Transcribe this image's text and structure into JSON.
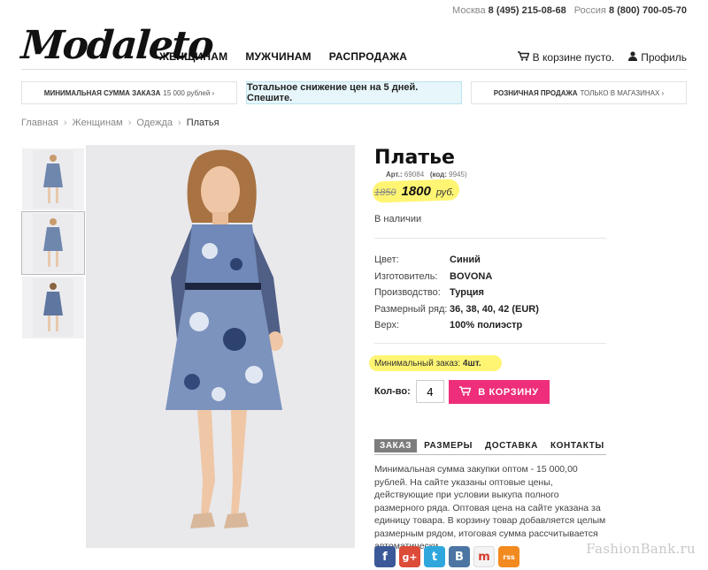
{
  "header": {
    "phone_moscow_label": "Москва",
    "phone_moscow": "8 (495) 215-08-68",
    "phone_russia_label": "Россия",
    "phone_russia": "8 (800) 700-05-70",
    "logo": "Modaleto",
    "nav": [
      "ЖЕНЩИНАМ",
      "МУЖЧИНАМ",
      "РАСПРОДАЖА"
    ],
    "cart_text": "В корзине пусто.",
    "profile_text": "Профиль"
  },
  "promo": {
    "left_bold": "МИНИМАЛЬНАЯ СУММА ЗАКАЗА",
    "left_rest": "15 000 рублей ›",
    "mid": "Тотальное снижение цен на 5 дней. Спешите.",
    "right_bold": "РОЗНИЧНАЯ ПРОДАЖА",
    "right_rest": "ТОЛЬКО В МАГАЗИНАХ ›"
  },
  "breadcrumb": [
    "Главная",
    "Женщинам",
    "Одежда",
    "Платья"
  ],
  "product": {
    "title": "Платье",
    "art_label": "Арт.:",
    "art": "69084",
    "code_label": "(код:",
    "code": "9945)",
    "old_price": "1850",
    "new_price": "1800",
    "currency": "руб.",
    "stock": "В наличии",
    "specs": [
      {
        "key": "Цвет:",
        "value": "Синий"
      },
      {
        "key": "Изготовитель:",
        "value": "BOVONA"
      },
      {
        "key": "Производство:",
        "value": "Турция"
      },
      {
        "key": "Размерный ряд:",
        "value": "36, 38, 40, 42 (EUR)"
      },
      {
        "key": "Верх:",
        "value": "100% полиэстр"
      }
    ],
    "min_order_label": "Минимальный заказ:",
    "min_order_value": "4шт.",
    "qty_label": "Кол-во:",
    "qty_value": "4",
    "buy_label": "В КОРЗИНУ"
  },
  "tabs": [
    "ЗАКАЗ",
    "РАЗМЕРЫ",
    "ДОСТАВКА",
    "КОНТАКТЫ"
  ],
  "tab_text": "Минимальная сумма закупки оптом - 15 000,00 рублей. На сайте указаны оптовые цены, действующие при условии выкупа полного размерного ряда. Оптовая цена на сайте указана за единицу товара. В корзину товар добавляется целым размерным рядом, итоговая сумма рассчитывается автоматически.",
  "social": [
    "f",
    "g+",
    "t",
    "B",
    "m",
    "rss"
  ],
  "watermark": "FashionBank.ru",
  "colors": {
    "accent": "#ee2e7a",
    "highlight": "#fff35a",
    "promo_bg": "#e6f6fb"
  }
}
